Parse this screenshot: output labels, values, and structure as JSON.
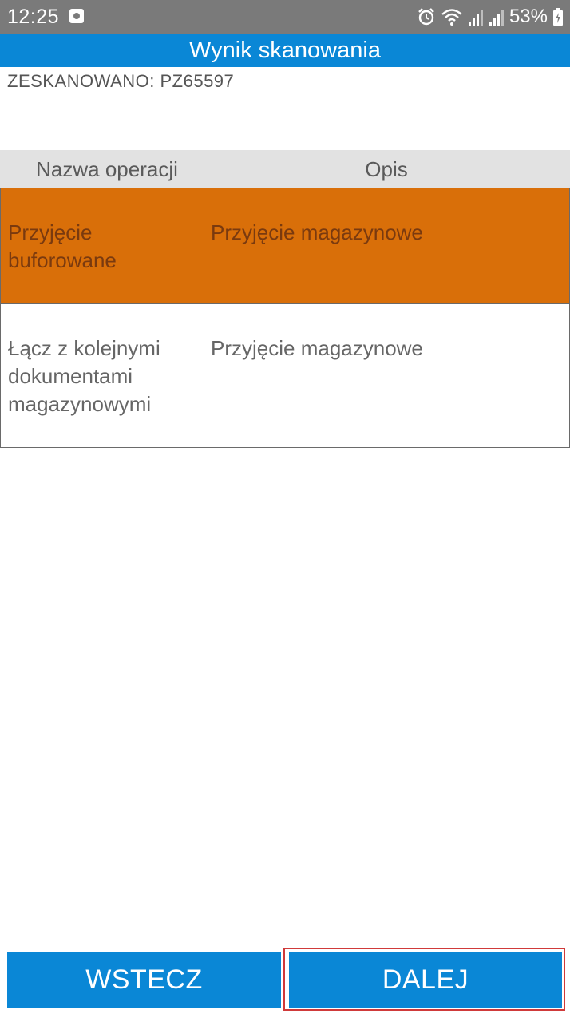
{
  "status_bar": {
    "time": "12:25",
    "battery": "53%",
    "icons": [
      "notification-icon",
      "alarm-icon",
      "wifi-icon",
      "signal-icon",
      "signal-icon",
      "battery-icon"
    ]
  },
  "header": {
    "title": "Wynik skanowania"
  },
  "scanned": {
    "text": "ZESKANOWANO: PZ65597"
  },
  "table": {
    "headers": [
      "Nazwa operacji",
      "Opis"
    ],
    "rows": [
      {
        "name": "Przyjęcie buforowane",
        "description": "Przyjęcie magazynowe",
        "selected": true
      },
      {
        "name": "Łącz z kolejnymi dokumentami magazynowymi",
        "description": "Przyjęcie magazynowe",
        "selected": false
      }
    ]
  },
  "buttons": {
    "back_label": "WSTECZ",
    "next_label": "DALEJ"
  },
  "colors": {
    "status_bar": "#7a7a7a",
    "accent": "#0a87d6",
    "selected_row": "#d96f09",
    "header_row": "#e2e2e2",
    "focus_outline": "#d03a3a"
  }
}
